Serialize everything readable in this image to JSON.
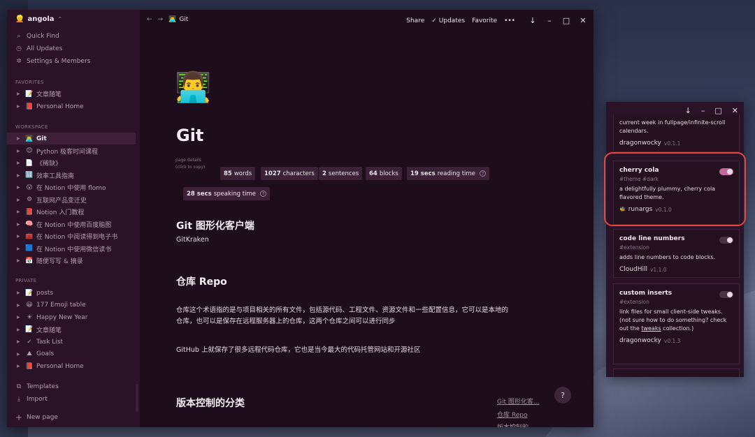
{
  "sidebar": {
    "workspace": "angola",
    "top_items": [
      {
        "icon": "search-icon",
        "label": "Quick Find"
      },
      {
        "icon": "clock-icon",
        "label": "All Updates"
      },
      {
        "icon": "gear-icon",
        "label": "Settings & Members"
      }
    ],
    "favorites_label": "FAVORITES",
    "favorites": [
      {
        "emoji": "📝",
        "label": "文章随笔"
      },
      {
        "emoji": "📕",
        "label": "Personal Home"
      }
    ],
    "workspace_label": "WORKSPACE",
    "workspace_pages": [
      {
        "emoji": "👨‍💻",
        "label": "Git",
        "active": true
      },
      {
        "emoji": "😊",
        "label": "Python 极客时间课程"
      },
      {
        "emoji": "📄",
        "label": "《稀缺》"
      },
      {
        "emoji": "🔢",
        "label": "效率工具指南"
      },
      {
        "emoji": "😮",
        "label": "在 Notion 中使用 flomo"
      },
      {
        "emoji": "⚙",
        "label": "互联网产品变迁史"
      },
      {
        "emoji": "📕",
        "label": "Notion 入门教程"
      },
      {
        "emoji": "🧠",
        "label": "在 Notion 中使用百度脑图"
      },
      {
        "emoji": "🧰",
        "label": "在 Notion 中阅读得到电子书"
      },
      {
        "emoji": "🟦",
        "label": "在 Notion 中使用微信读书"
      },
      {
        "emoji": "📅",
        "label": "随便写写 & 摘录"
      }
    ],
    "private_label": "PRIVATE",
    "private_pages": [
      {
        "emoji": "📝",
        "label": "posts"
      },
      {
        "emoji": "😀",
        "label": "177 Emoji table"
      },
      {
        "emoji": "☀",
        "label": "Happy New Year"
      },
      {
        "emoji": "📝",
        "label": "文章随笔"
      },
      {
        "emoji": "✓",
        "label": "Task List"
      },
      {
        "emoji": "⛰",
        "label": "Goals"
      },
      {
        "emoji": "📕",
        "label": "Personal Home"
      }
    ],
    "templates_label": "Templates",
    "import_label": "Import",
    "new_page_label": "New page"
  },
  "topbar": {
    "breadcrumb": "Git",
    "share": "Share",
    "updates": "Updates",
    "favorite": "Favorite",
    "more": "•••"
  },
  "page": {
    "title": "Git",
    "details_label_1": "page details",
    "details_label_2": "(click to copy)",
    "stats": [
      {
        "num": "85",
        "unit": "words"
      },
      {
        "num": "1027",
        "unit": "characters"
      },
      {
        "num": "2",
        "unit": "sentences"
      },
      {
        "num": "64",
        "unit": "blocks"
      },
      {
        "num": "19 secs",
        "unit": "reading time"
      },
      {
        "num": "28 secs",
        "unit": "speaking time"
      }
    ],
    "h_gui": "Git 图形化客户端",
    "p_gui": "GitKraken",
    "h_repo": "仓库 Repo",
    "p_repo_1": "仓库这个术语指的是与项目相关的所有文件，包括源代码、工程文件、资源文件和一些配置信息，它可以是本地的",
    "p_repo_2": "仓库，也可以是保存在远程服务器上的仓库，这两个仓库之间可以进行同步",
    "p_github": "GitHub 上就保存了很多远程代码仓库，它也是当今最大的代码托管网站和开源社区",
    "h_types": "版本控制的分类",
    "toc": [
      "Git 图形化客...",
      "仓库 Repo",
      "版本控制的..."
    ],
    "help": "?"
  },
  "panel": {
    "prev_card_desc": "current week in fullpage/infinite-scroll calendars.",
    "prev_card_author": "dragonwocky",
    "prev_card_ver": "v0.1.1",
    "cards": [
      {
        "name": "cherry cola",
        "tags": "#theme #dark",
        "desc": "a delightfully plummy, cherry cola flavored theme.",
        "author": "runargs",
        "ver": "v0.1.0"
      },
      {
        "name": "code line numbers",
        "tags": "#extension",
        "desc": "adds line numbers to code blocks.",
        "author": "CloudHill",
        "ver": "v1.1.0"
      },
      {
        "name": "custom inserts",
        "tags": "#extension",
        "desc_1": "link files for small client-side tweaks. (not sure how to do something? check out the",
        "desc_link": "tweaks",
        "desc_2": " collection.)",
        "author": "dragonwocky",
        "ver": "v0.1.3"
      }
    ]
  },
  "colors": {
    "accent": "#c2689d",
    "highlight": "#e8473f",
    "background": "#1e0d1b"
  }
}
